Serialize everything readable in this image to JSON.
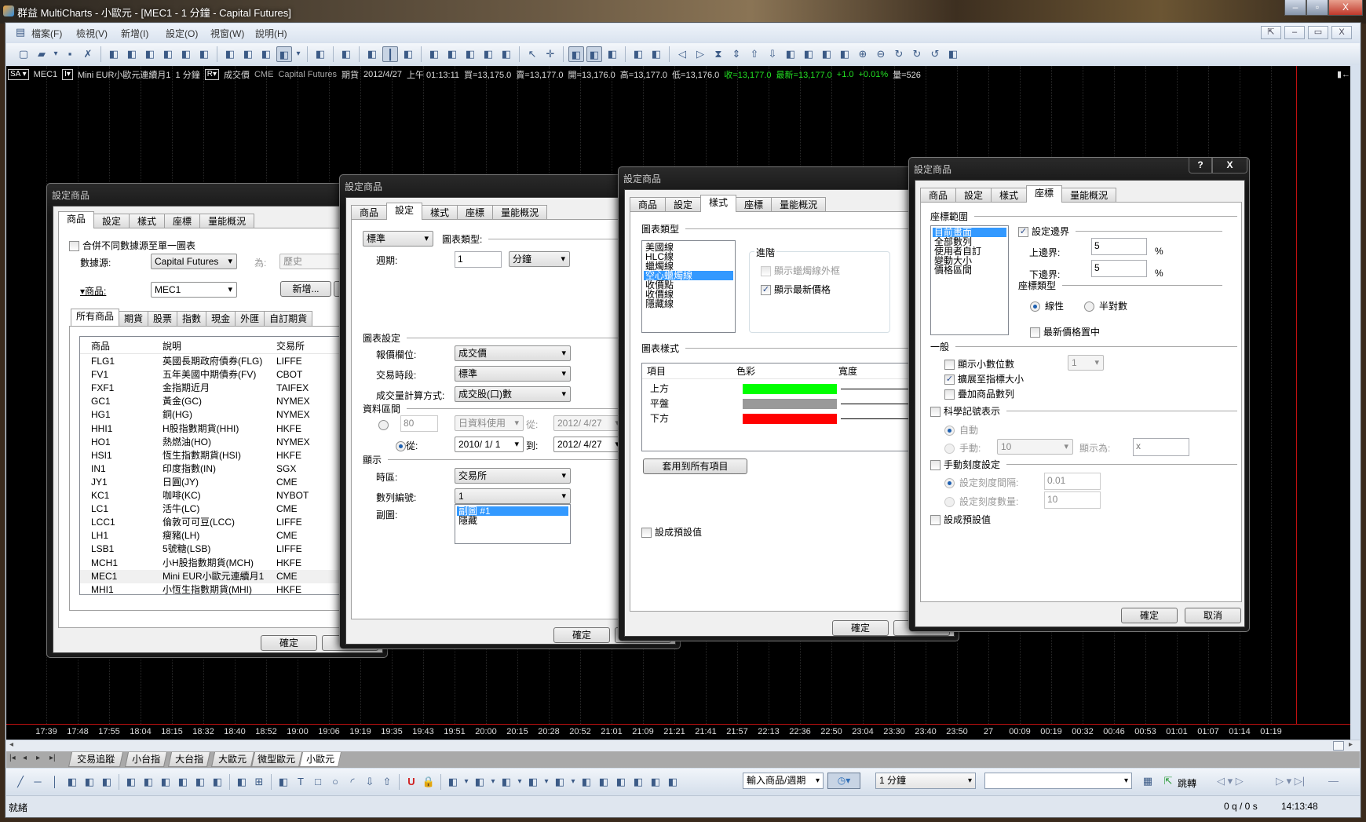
{
  "app": {
    "title": "群益 MultiCharts - 小歐元 - [MEC1 - 1 分鐘 - Capital Futures]",
    "win_min": "‒",
    "win_max": "▫",
    "win_close": "X"
  },
  "menu": {
    "items": [
      "檔案(F)",
      "檢視(V)",
      "新增(I)",
      "設定(O)",
      "視窗(W)",
      "說明(H)"
    ],
    "mdi": [
      "⇱",
      "‒",
      "▭",
      "X"
    ]
  },
  "toolbar": {
    "icons": [
      "new-window-icon",
      "open-folder-icon",
      "dropdown-icon",
      "save-icon",
      "delete-icon",
      "|",
      "doc-1-icon",
      "doc-2-icon",
      "doc-3-icon",
      "formula-icon",
      "doc-list-icon",
      "doc-chart-icon",
      "|",
      "insert-study-icon",
      "insert-line-icon",
      "insert-signal-icon",
      "drawing-tool-icon",
      "dropdown-icon",
      "|",
      "strategy-icon",
      "|",
      "format-icon",
      "|",
      "bar-icon",
      "candle-icon",
      "tick-icon",
      "|",
      "point-figure-icon",
      "kagi-icon",
      "renko-icon",
      "cross-icon",
      "volume-icon",
      "|",
      "pointer-icon",
      "crosshair-icon",
      "|",
      "tooltip-icon",
      "data-window-icon",
      "scale-icon",
      "|",
      "window-icon",
      "chart-window-icon",
      "|",
      "scroll-left-icon",
      "scroll-right-icon",
      "compress-icon",
      "expand-icon",
      "bar-up-icon",
      "bar-down-icon",
      "shift-left-icon",
      "shift-right-icon",
      "anchor-icon",
      "anchor2-icon",
      "zoom-in-icon",
      "zoom-out-icon",
      "refresh-icon",
      "refresh2-icon",
      "reload-icon",
      "zoom-reset-icon"
    ]
  },
  "info": {
    "sa": "SA ▾",
    "symbol": "MEC1",
    "desc_box": "I▾",
    "desc": "Mini EUR小歐元連續月1",
    "interval": "1 分鐘",
    "r_box": "R▾",
    "field": "成交價",
    "exchange": "CME",
    "source": "Capital Futures",
    "category": "期貨",
    "date": "2012/4/27",
    "time": "上午 01:13:11",
    "bid": "買=13,175.0",
    "ask": "賣=13,177.0",
    "open": "開=13,176.0",
    "high": "高=13,177.0",
    "low": "低=13,176.0",
    "close": "收=13,177.0",
    "last": "最新=13,177.0",
    "chg": "+1.0",
    "pct": "+0.01%",
    "vol": "量=526",
    "right_icon": "▮←"
  },
  "chart": {
    "time_labels": [
      "17:39",
      "17:48",
      "17:55",
      "18:04",
      "18:15",
      "18:32",
      "18:40",
      "18:52",
      "19:00",
      "19:06",
      "19:19",
      "19:35",
      "19:43",
      "19:51",
      "20:00",
      "20:15",
      "20:28",
      "20:52",
      "21:01",
      "21:09",
      "21:21",
      "21:41",
      "21:57",
      "22:13",
      "22:36",
      "22:50",
      "23:04",
      "23:30",
      "23:40",
      "23:50",
      "27",
      "00:09",
      "00:19",
      "00:32",
      "00:46",
      "00:53",
      "01:01",
      "01:07",
      "01:14",
      "01:19"
    ],
    "background": "#000000",
    "marker_line": "#c01010"
  },
  "sheet_tabs": {
    "nav": [
      "|◂",
      "◂",
      "▸",
      "▸|"
    ],
    "items": [
      "交易追蹤",
      "小台指",
      "大台指",
      "大歐元",
      "微型歐元",
      "小歐元"
    ],
    "active": 5
  },
  "drawbar": {
    "icons": [
      "line-icon",
      "horizontal-line-icon",
      "vertical-line-icon",
      "parallel-channel-icon",
      "trend-channel-icon",
      "fib-fan-icon",
      "|",
      "fib-levels-icon",
      "angle-icon",
      "fib-extension-icon",
      "gann-fan-icon",
      "time-zones-icon",
      "cycle-icon",
      "|",
      "regression-icon",
      "grid-icon",
      "|",
      "text-list-icon",
      "text-icon",
      "rectangle-icon",
      "ellipse-icon",
      "arc-icon",
      "arrow-down-icon",
      "arrow-up-icon",
      "|",
      "magnet-icon",
      "lock-icon",
      "|",
      "tick-chart-icon",
      "dropdown-icon",
      "volume-chart-icon",
      "dropdown-icon",
      "range-chart-icon",
      "dropdown-icon",
      "seconds-icon",
      "dropdown-icon",
      "minutes-icon",
      "dropdown-icon",
      "hours-icon",
      "day-icon",
      "week-icon",
      "month-icon",
      "quarter-icon",
      "year-icon"
    ],
    "symbol_combo": "輸入商品/週期",
    "interval_combo": "1 分鐘",
    "search_combo": "",
    "jump": "跳轉"
  },
  "status": {
    "ready": "就緒",
    "quotes": "0 q / 0 s",
    "clock": "14:13:48"
  },
  "dialogs": {
    "title": "設定商品",
    "tabs": [
      "商品",
      "設定",
      "樣式",
      "座標",
      "量能概況"
    ],
    "ok": "確定",
    "cancel": "取消",
    "help": "?",
    "close": "X",
    "d1": {
      "merge": "合併不同數據源至單一圖表",
      "source_label": "數據源:",
      "source": "Capital Futures",
      "as_label": "為:",
      "as_value": "歷史",
      "symbol_label": "▾商品:",
      "symbol": "MEC1",
      "add": "新增...",
      "sub_tabs": [
        "所有商品",
        "期貨",
        "股票",
        "指數",
        "現金",
        "外匯",
        "自訂期貨"
      ],
      "columns": [
        "商品",
        "說明",
        "交易所"
      ],
      "rows": [
        [
          "FLG1",
          "英國長期政府債券(FLG)",
          "LIFFE"
        ],
        [
          "FV1",
          "五年美國中期債券(FV)",
          "CBOT"
        ],
        [
          "FXF1",
          "金指期近月",
          "TAIFEX"
        ],
        [
          "GC1",
          "黃金(GC)",
          "NYMEX"
        ],
        [
          "HG1",
          "銅(HG)",
          "NYMEX"
        ],
        [
          "HHI1",
          "H股指數期貨(HHI)",
          "HKFE"
        ],
        [
          "HO1",
          "熱燃油(HO)",
          "NYMEX"
        ],
        [
          "HSI1",
          "恆生指數期貨(HSI)",
          "HKFE"
        ],
        [
          "IN1",
          "印度指數(IN)",
          "SGX"
        ],
        [
          "JY1",
          "日圓(JY)",
          "CME"
        ],
        [
          "KC1",
          "咖啡(KC)",
          "NYBOT"
        ],
        [
          "LC1",
          "活牛(LC)",
          "CME"
        ],
        [
          "LCC1",
          "倫敦可可豆(LCC)",
          "LIFFE"
        ],
        [
          "LH1",
          "瘦豬(LH)",
          "CME"
        ],
        [
          "LSB1",
          "5號糖(LSB)",
          "LIFFE"
        ],
        [
          "MCH1",
          "小H股指數期貨(MCH)",
          "HKFE"
        ],
        [
          "MEC1",
          "Mini EUR小歐元連續月1",
          "CME"
        ],
        [
          "MHI1",
          "小恆生指數期貨(MHI)",
          "HKFE"
        ]
      ],
      "selected_row": 16
    },
    "d2": {
      "type_combo": "標準",
      "chart_type": "圖表類型:",
      "period_label": "週期:",
      "period": "1",
      "period_unit": "分鐘",
      "chart_settings": "圖表設定",
      "quote_field_label": "報價欄位:",
      "quote_field": "成交價",
      "session_label": "交易時段:",
      "session": "標準",
      "volume_label": "成交量計算方式:",
      "volume": "成交股(口)數",
      "range": "資料區間",
      "bars": "80",
      "bars_unit": "日資料使用",
      "from_label": "從:",
      "from_date_dis": "2012/ 4/27",
      "from": "2010/ 1/ 1",
      "to_label": "到:",
      "to": "2012/ 4/27",
      "display": "顯示",
      "tz_label": "時區:",
      "tz": "交易所",
      "series_label": "數列編號:",
      "series": "1",
      "subchart_label": "副圖:",
      "subcharts": [
        "副圖 #1",
        "隱藏"
      ]
    },
    "d3": {
      "chart_type": "圖表類型",
      "types": [
        "美國線",
        "HLC線",
        "蠟燭線",
        "空心蠟燭線",
        "收價點",
        "收價線",
        "隱藏線"
      ],
      "selected_type": 3,
      "advanced": "進階",
      "show_outline": "顯示蠟燭線外框",
      "show_last": "顯示最新價格",
      "chart_style": "圖表樣式",
      "columns": [
        "項目",
        "色彩",
        "寬度"
      ],
      "rows": [
        {
          "label": "上方",
          "color": "#00ff00"
        },
        {
          "label": "平盤",
          "color": "#999999"
        },
        {
          "label": "下方",
          "color": "#ff0000"
        }
      ],
      "apply_all": "套用到所有項目",
      "set_default": "設成預設值"
    },
    "d4": {
      "range": "座標範圍",
      "ranges": [
        "目前畫面",
        "全部數列",
        "使用者自訂",
        "變動大小",
        "價格區間"
      ],
      "selected_range": 0,
      "set_margin": "設定邊界",
      "top_label": "上邊界:",
      "top": "5",
      "bottom_label": "下邊界:",
      "bottom": "5",
      "pct": "%",
      "scale_type": "座標類型",
      "linear": "線性",
      "semilog": "半對數",
      "center_last": "最新價格置中",
      "general": "一般",
      "show_decimals": "顯示小數位數",
      "decimals": "1",
      "extend": "擴展至指標大小",
      "overlay": "疊加商品數列",
      "sci": "科學記號表示",
      "auto": "自動",
      "manual": "手動:",
      "manual_value": "10",
      "show_as": "顯示為:",
      "show_as_value": "x",
      "manual_ticks": "手動刻度設定",
      "tick_interval": "設定刻度間隔:",
      "tick_interval_value": "0.01",
      "tick_count": "設定刻度數量:",
      "tick_count_value": "10",
      "set_default": "設成預設值"
    }
  }
}
